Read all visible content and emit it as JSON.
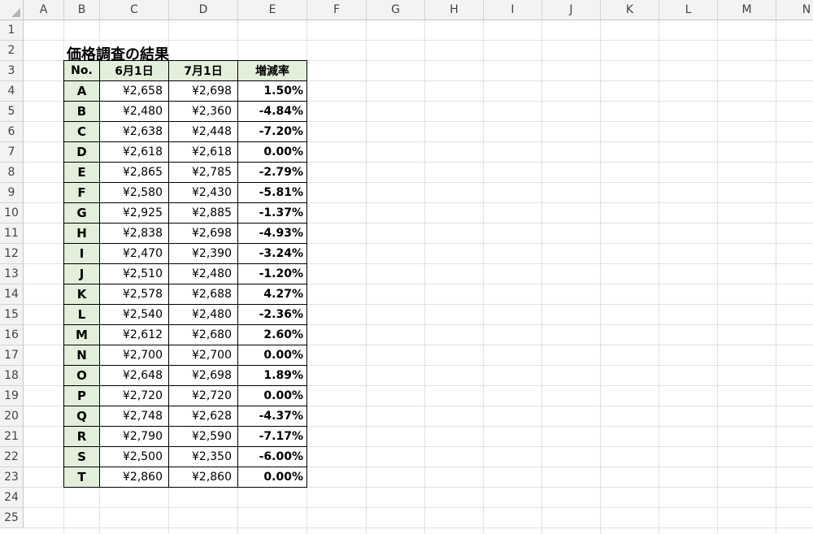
{
  "columns": [
    "A",
    "B",
    "C",
    "D",
    "E",
    "F",
    "G",
    "H",
    "I",
    "J",
    "K",
    "L",
    "M",
    "N"
  ],
  "rows": [
    "1",
    "2",
    "3",
    "4",
    "5",
    "6",
    "7",
    "8",
    "9",
    "10",
    "11",
    "12",
    "13",
    "14",
    "15",
    "16",
    "17",
    "18",
    "19",
    "20",
    "21",
    "22",
    "23",
    "24",
    "25"
  ],
  "title": "価格調査の結果",
  "table": {
    "headers": [
      "No.",
      "6月1日",
      "7月1日",
      "増減率"
    ],
    "rows": [
      {
        "id": "A",
        "jun": "¥2,658",
        "jul": "¥2,698",
        "rate": "1.50%"
      },
      {
        "id": "B",
        "jun": "¥2,480",
        "jul": "¥2,360",
        "rate": "-4.84%"
      },
      {
        "id": "C",
        "jun": "¥2,638",
        "jul": "¥2,448",
        "rate": "-7.20%"
      },
      {
        "id": "D",
        "jun": "¥2,618",
        "jul": "¥2,618",
        "rate": "0.00%"
      },
      {
        "id": "E",
        "jun": "¥2,865",
        "jul": "¥2,785",
        "rate": "-2.79%"
      },
      {
        "id": "F",
        "jun": "¥2,580",
        "jul": "¥2,430",
        "rate": "-5.81%"
      },
      {
        "id": "G",
        "jun": "¥2,925",
        "jul": "¥2,885",
        "rate": "-1.37%"
      },
      {
        "id": "H",
        "jun": "¥2,838",
        "jul": "¥2,698",
        "rate": "-4.93%"
      },
      {
        "id": "I",
        "jun": "¥2,470",
        "jul": "¥2,390",
        "rate": "-3.24%"
      },
      {
        "id": "J",
        "jun": "¥2,510",
        "jul": "¥2,480",
        "rate": "-1.20%"
      },
      {
        "id": "K",
        "jun": "¥2,578",
        "jul": "¥2,688",
        "rate": "4.27%"
      },
      {
        "id": "L",
        "jun": "¥2,540",
        "jul": "¥2,480",
        "rate": "-2.36%"
      },
      {
        "id": "M",
        "jun": "¥2,612",
        "jul": "¥2,680",
        "rate": "2.60%"
      },
      {
        "id": "N",
        "jun": "¥2,700",
        "jul": "¥2,700",
        "rate": "0.00%"
      },
      {
        "id": "O",
        "jun": "¥2,648",
        "jul": "¥2,698",
        "rate": "1.89%"
      },
      {
        "id": "P",
        "jun": "¥2,720",
        "jul": "¥2,720",
        "rate": "0.00%"
      },
      {
        "id": "Q",
        "jun": "¥2,748",
        "jul": "¥2,628",
        "rate": "-4.37%"
      },
      {
        "id": "R",
        "jun": "¥2,790",
        "jul": "¥2,590",
        "rate": "-7.17%"
      },
      {
        "id": "S",
        "jun": "¥2,500",
        "jul": "¥2,350",
        "rate": "-6.00%"
      },
      {
        "id": "T",
        "jun": "¥2,860",
        "jul": "¥2,860",
        "rate": "0.00%"
      }
    ]
  },
  "colors": {
    "header_fill": "#e2efda",
    "gridline": "#e1e1e1",
    "heading_bg": "#f3f3f3"
  }
}
